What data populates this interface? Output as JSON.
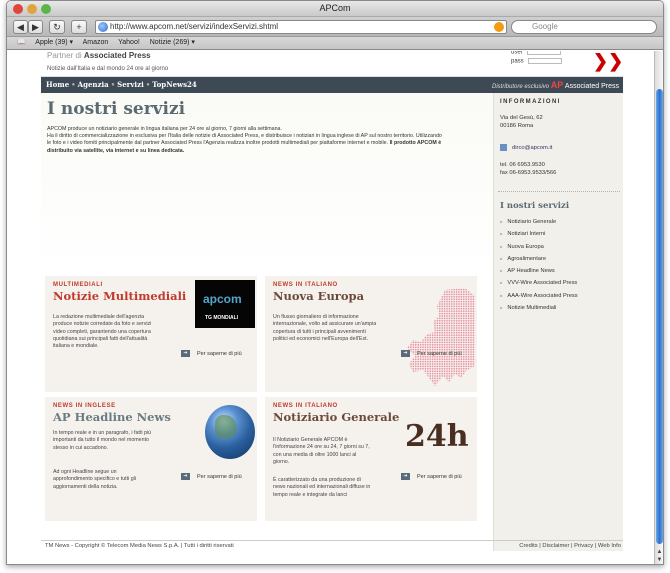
{
  "browser": {
    "window_title": "APCom",
    "url": "http://www.apcom.net/servizi/indexServizi.shtml",
    "search_placeholder": "Google",
    "bookmarks": [
      "Apple (39) ▾",
      "Amazon",
      "Yahoo!",
      "Notizie (269) ▾"
    ]
  },
  "header": {
    "partner_prefix": "Partner di",
    "partner_name": "Associated Press",
    "tagline": "Notizie dall'Italia e dal mondo 24 ore al giorno",
    "login_user_label": "user",
    "login_pass_label": "pass",
    "go_symbol": "❯❯"
  },
  "nav": {
    "items": [
      "Home",
      "Agenzia",
      "Servizi",
      "TopNews24"
    ],
    "separator": "•",
    "distributor_note": "Distributore esclusivo",
    "ap_logo": "AP",
    "ap_name": "Associated Press"
  },
  "main": {
    "title": "I nostri servizi",
    "intro_1": "APCOM produce un notiziario generale in lingua italiana per 24 ore al giorno, 7 giorni alla settimana.",
    "intro_2": "Ha il diritto di commercializzazione in esclusiva per l'Italia delle notizie di Associated Press, e distribuisce i notiziari in lingua inglese di AP sul nostro territorio. Utilizzando le foto e i video forniti principalmente dal partner Associated Press l'Agenzia realizza inoltre prodotti multimediali per piattaforme internet e mobile.",
    "intro_bold": "Il prodotto APCOM è distribuito via satellite, via internet e su linea dedicata.",
    "more_label": "Per saperne di più",
    "cards": [
      {
        "kicker": "MULTIMEDIALI",
        "title": "Notizie Multimediali",
        "text": "La redazione multimediale dell'agenzia produce notizie corredate da foto e servizi video completi, garantendo una copertura quotidiana sui principali fatti dell'attualità italiana e mondiale.",
        "image_caption": "TG MONDIALI",
        "image_logo": "apcom"
      },
      {
        "kicker": "NEWS IN ITALIANO",
        "title": "Nuova Europa",
        "text": "Un flusso giornaliero di informazione internazionale, volto ad assicurare un'ampia copertura di tutti i principali avvenimenti politici ed economici nell'Europa dell'Est."
      },
      {
        "kicker": "NEWS IN INGLESE",
        "title": "AP Headline News",
        "text": "In tempo reale e in un paragrafo, i fatti più importanti da tutto il mondo nel momento stesso in cui accadono.",
        "text2": "Ad ogni Headline segue un approfondimento specifico e tutti gli aggiornamenti della notizia."
      },
      {
        "kicker": "NEWS IN ITALIANO",
        "title": "Notiziario Generale",
        "text": "Il Notiziario Generale APCOM è l'informazione 24 ore su 24, 7 giorni su 7, con una media di oltre 1000 lanci al giorno.",
        "text2": "È caratterizzato da una produzione di news nazionali ed internazionali diffuse in tempo reale e integrate da lanci",
        "badge": "24h"
      }
    ]
  },
  "sidebar": {
    "info_heading": "INFORMAZIONI",
    "address_1": "Via del Gesù, 62",
    "address_2": "00186 Roma",
    "email": "dirco@apcom.it",
    "tel": "tel. 06 6953.9530",
    "fax": "fax 06-6953.9533/566",
    "services_heading": "I nostri servizi",
    "services": [
      "Notiziario Generale",
      "Notiziari Interni",
      "Nuova Europa",
      "Agroalimentare",
      "AP Headline News",
      "VVV-Wire Associated Press",
      "AAA-Wire Associated Press",
      "Notizie Multimediali"
    ]
  },
  "footer": {
    "copyright": "TM News - Copyright © Telecom Media News S.p.A. | Tutti i diritti riservati",
    "links": "Credits | Disclaimer | Privacy | Web Info"
  },
  "colors": {
    "accent_red": "#c0392b",
    "nav_bg": "#3d4a56",
    "heading_slate": "#5a6a70"
  }
}
